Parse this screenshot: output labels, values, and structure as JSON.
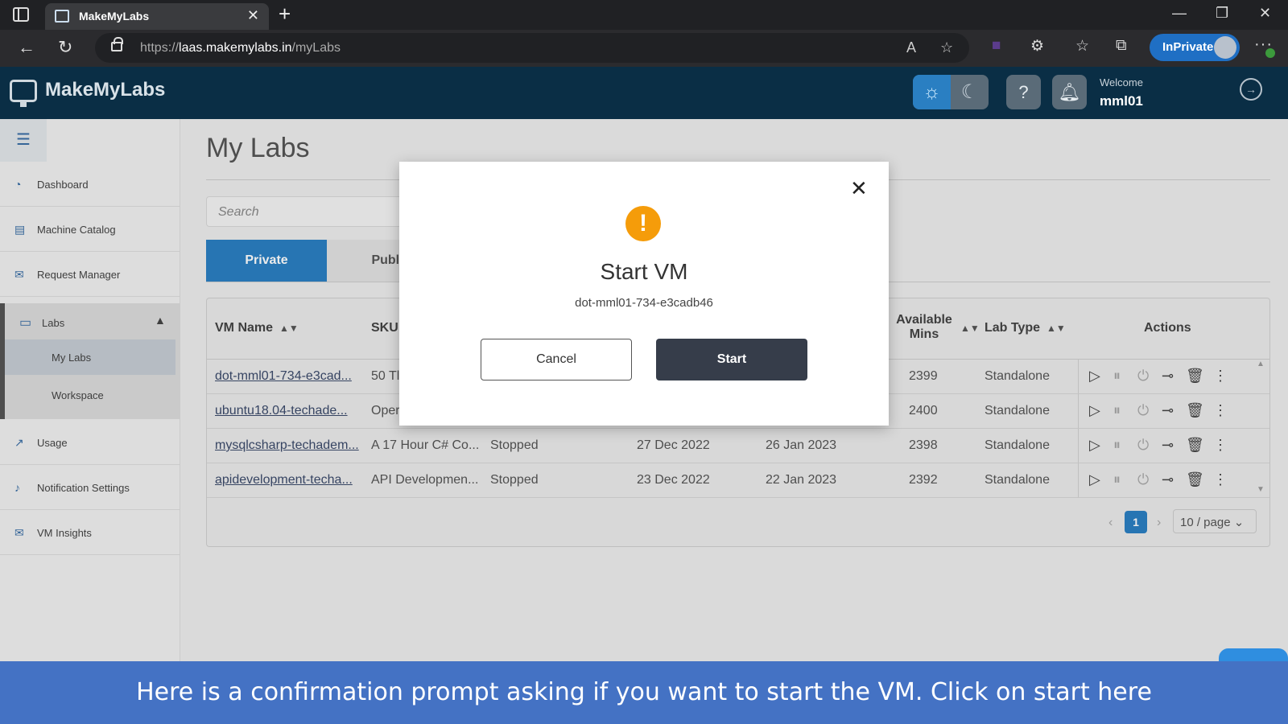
{
  "browser": {
    "tab_title": "MakeMyLabs",
    "url_scheme": "https://",
    "url_host": "laas.makemylabs.in",
    "url_path": "/myLabs",
    "inprivate_label": "InPrivate"
  },
  "header": {
    "logo_text": "MakeMyLabs",
    "welcome": "Welcome",
    "username": "mml01"
  },
  "sidebar": {
    "items": [
      {
        "label": "Dashboard",
        "icon": "gauge-icon"
      },
      {
        "label": "Machine Catalog",
        "icon": "catalog-icon"
      },
      {
        "label": "Request Manager",
        "icon": "mail-icon"
      },
      {
        "label": "Labs",
        "icon": "monitor-icon"
      },
      {
        "label": "Usage",
        "icon": "chart-line-icon"
      },
      {
        "label": "Notification Settings",
        "icon": "bell-icon"
      },
      {
        "label": "VM Insights",
        "icon": "mail-icon"
      }
    ],
    "labs_children": [
      {
        "label": "My Labs"
      },
      {
        "label": "Workspace"
      }
    ]
  },
  "main": {
    "page_title": "My Labs",
    "search_placeholder": "Search",
    "tabs": [
      {
        "label": "Private"
      },
      {
        "label": "Publi"
      }
    ],
    "table": {
      "headers": {
        "vm_name": "VM Name",
        "sku": "SKU",
        "available_mins_1": "Available",
        "available_mins_2": "Mins",
        "lab_type": "Lab Type",
        "actions": "Actions"
      },
      "rows": [
        {
          "vm_name": "dot-mml01-734-e3cad...",
          "sku": "50 Tl",
          "status": "",
          "created": "",
          "expires": "",
          "mins": "2399",
          "lab_type": "Standalone"
        },
        {
          "vm_name": "ubuntu18.04-techade...",
          "sku": "Oper",
          "status": "",
          "created": "",
          "expires": "",
          "mins": "2400",
          "lab_type": "Standalone"
        },
        {
          "vm_name": "mysqlcsharp-techadem...",
          "sku": "A 17 Hour C# Co...",
          "status": "Stopped",
          "created": "27 Dec 2022",
          "expires": "26 Jan 2023",
          "mins": "2398",
          "lab_type": "Standalone"
        },
        {
          "vm_name": "apidevelopment-techa...",
          "sku": "API Developmen...",
          "status": "Stopped",
          "created": "23 Dec 2022",
          "expires": "22 Jan 2023",
          "mins": "2392",
          "lab_type": "Standalone"
        }
      ]
    },
    "pagination": {
      "current_page": "1",
      "page_size": "10 / page"
    }
  },
  "modal": {
    "title": "Start VM",
    "subtitle": "dot-mml01-734-e3cadb46",
    "cancel_label": "Cancel",
    "start_label": "Start"
  },
  "caption": "Here is a confirmation prompt asking if you want to start the VM. Click on start here",
  "colors": {
    "header_bg": "#0a2e45",
    "accent": "#2b7fc3",
    "warning": "#f59c0a",
    "start_button": "#363d4a",
    "caption_bg": "#4472c4"
  }
}
